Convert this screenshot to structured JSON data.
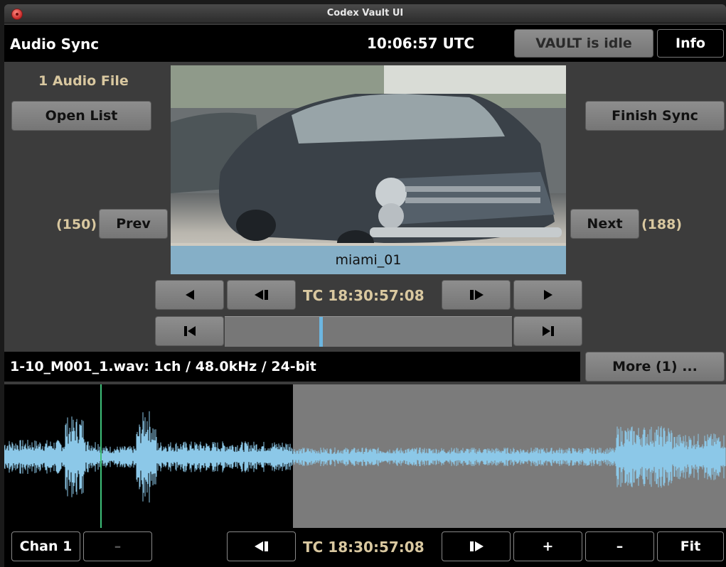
{
  "window": {
    "title": "Codex Vault UI"
  },
  "header": {
    "screen_title": "Audio Sync",
    "clock": "10:06:57 UTC",
    "vault_status": "VAULT is idle",
    "info_label": "Info"
  },
  "left_panel": {
    "audio_count": "1 Audio File",
    "open_list_label": "Open List",
    "prev_count": "(150)",
    "prev_label": "Prev"
  },
  "right_panel": {
    "finish_sync_label": "Finish Sync",
    "next_label": "Next",
    "next_count": "(188)"
  },
  "video": {
    "clip_name": "miami_01"
  },
  "transport": {
    "play_reverse_icon": "triangle-left",
    "step_back_icon": "step-back",
    "timecode": "TC 18:30:57:08",
    "step_forward_icon": "step-forward",
    "play_icon": "triangle-right",
    "go_start_icon": "skip-start",
    "go_end_icon": "skip-end",
    "scrub_position": 0.33
  },
  "file_info": {
    "text": "1-10_M001_1.wav: 1ch / 48.0kHz / 24-bit",
    "more_label": "More (1) ..."
  },
  "waveform": {
    "color": "#8cc8e8",
    "cursor_color": "#3ec07a"
  },
  "bottom_bar": {
    "channel_label": "Chan 1",
    "channel_minus_label": "–",
    "timecode": "TC 18:30:57:08",
    "zoom_in_label": "+",
    "zoom_out_label": "–",
    "fit_label": "Fit"
  }
}
